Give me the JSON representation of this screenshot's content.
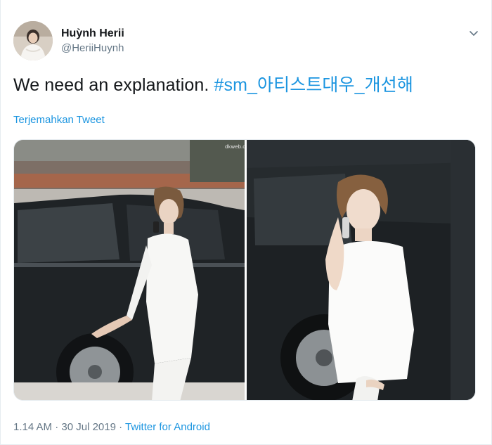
{
  "user": {
    "display_name": "Huỳnh Herii",
    "handle": "@HeriiHuynh"
  },
  "tweet": {
    "text": "We need an explanation. ",
    "hashtag": "#sm_아티스트대우_개선해",
    "translate_label": "Terjemahkan Tweet"
  },
  "media": {
    "watermark": "dkweb.com"
  },
  "footer": {
    "time": "1.14 AM",
    "separator": " · ",
    "date": "30 Jul 2019",
    "separator2": " · ",
    "source": "Twitter for Android"
  },
  "colors": {
    "accent": "#1b95e0",
    "secondary_text": "#657786",
    "primary_text": "#14171a"
  },
  "icons": {
    "menu": "chevron-down-icon",
    "avatar": "avatar"
  }
}
